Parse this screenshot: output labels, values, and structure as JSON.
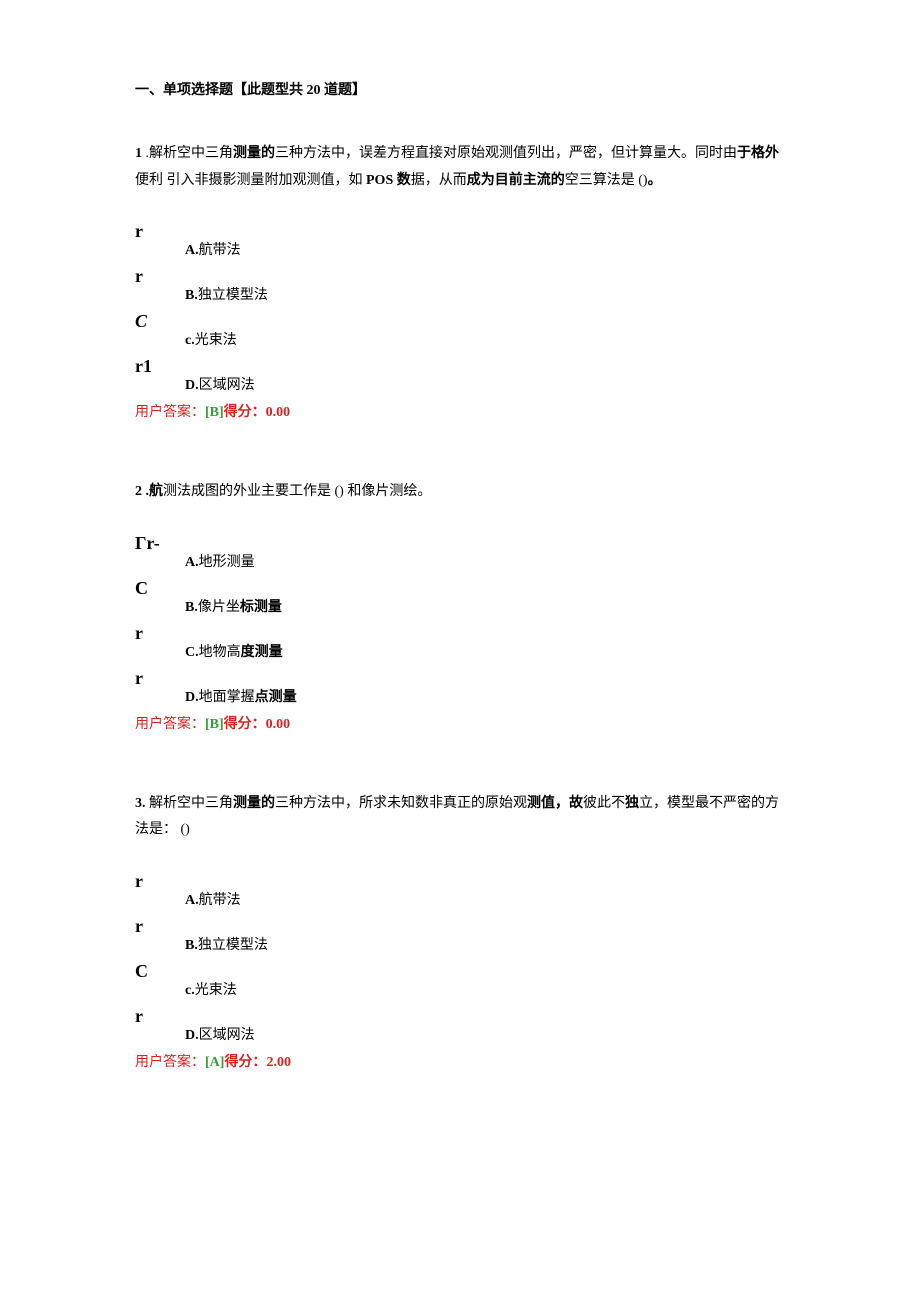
{
  "section_title": "一、单项选择题【此题型共 20 道题】",
  "questions": [
    {
      "number": "1",
      "stem_parts": [
        {
          "t": " .解析空中三角",
          "b": false
        },
        {
          "t": "测量的",
          "b": true
        },
        {
          "t": "三种方法中，误差方程直接对原始观测值列出，严密，但计算量大。同时由",
          "b": false
        },
        {
          "t": "于格外",
          "b": true
        },
        {
          "t": "便利\n引入非摄影测量附加观测值，如 ",
          "b": false
        },
        {
          "t": "POS 数",
          "b": true
        },
        {
          "t": "据，从而",
          "b": false
        },
        {
          "t": "成为目前主流的",
          "b": true
        },
        {
          "t": "空三算法是 ()",
          "b": false
        },
        {
          "t": "。",
          "b": true
        }
      ],
      "options": [
        {
          "mark": "r",
          "mark_class": "",
          "letter": "A.",
          "text": "航带法"
        },
        {
          "mark": "r",
          "mark_class": "",
          "letter": "B.",
          "text": "独立模型法"
        },
        {
          "mark": "C",
          "mark_class": "italic",
          "letter": "c.",
          "text": "光束法",
          "lower": true
        },
        {
          "mark": "r1",
          "mark_class": "",
          "letter": "D.",
          "text": "区域网法"
        }
      ],
      "answer_prefix": "用户答案：",
      "answer_choice": "[B]",
      "score_label": "得分：",
      "score_value": "0.00"
    },
    {
      "number": "2",
      "stem_parts": [
        {
          "t": " .",
          "b": true
        },
        {
          "t": "航",
          "b": true
        },
        {
          "t": "测法成图的外业主要工作是 () 和像片测绘。",
          "b": false
        }
      ],
      "options": [
        {
          "mark": "Γr-",
          "mark_class": "",
          "letter": "A.",
          "text": "地形测量"
        },
        {
          "mark": "C",
          "mark_class": "",
          "letter": "B.",
          "text": "像片坐",
          "text2": "标测量"
        },
        {
          "mark": "r",
          "mark_class": "",
          "letter": "C.",
          "text": "地物高",
          "text2": "度测量"
        },
        {
          "mark": "r",
          "mark_class": "",
          "letter": "D.",
          "text": "地面掌握",
          "text2": "点测量"
        }
      ],
      "answer_prefix": "用户答案：",
      "answer_choice": "[B]",
      "score_label": "得分：",
      "score_value": "0.00"
    },
    {
      "number": "3.",
      "stem_parts": [
        {
          "t": "解析空中三角",
          "b": false
        },
        {
          "t": "测量的",
          "b": true
        },
        {
          "t": "三种方法中，所求未知数非真正的原始观",
          "b": false
        },
        {
          "t": "测值，故",
          "b": true
        },
        {
          "t": "彼此不",
          "b": false
        },
        {
          "t": "独",
          "b": true
        },
        {
          "t": "立，模型最不严密的方法是：\n()",
          "b": false
        }
      ],
      "options": [
        {
          "mark": "r",
          "mark_class": "",
          "letter": "A.",
          "text": "航带法"
        },
        {
          "mark": "r",
          "mark_class": "",
          "letter": "B.",
          "text": "独立模型法"
        },
        {
          "mark": "C",
          "mark_class": "",
          "letter": "c.",
          "text": "光束法",
          "lower": true
        },
        {
          "mark": "r",
          "mark_class": "",
          "letter": "D.",
          "text": "区域网法"
        }
      ],
      "answer_prefix": "用户答案：",
      "answer_choice": "[A]",
      "score_label": "得分：",
      "score_value": "2.00"
    }
  ]
}
